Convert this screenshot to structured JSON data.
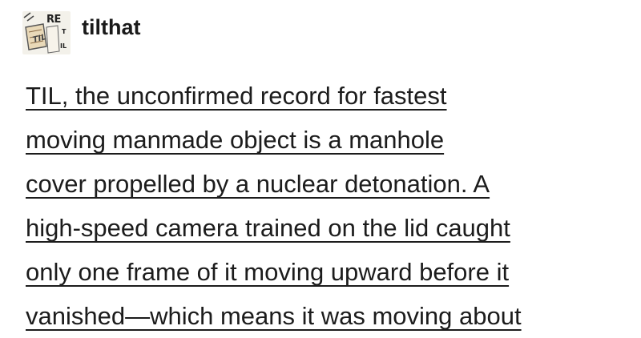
{
  "post": {
    "header": {
      "avatar": {
        "icon": "til-avatar-icon",
        "lettering": [
          "RE",
          "TIL",
          "T",
          "IL"
        ]
      },
      "username": "tilthat"
    },
    "body": {
      "lines": [
        "TIL, the unconfirmed record for fastest",
        "moving manmade object is a manhole",
        "cover propelled by a nuclear detonation. A",
        "high-speed camera trained on the lid caught",
        "only one frame of it moving upward before it",
        "vanished—which means it was moving about"
      ]
    }
  }
}
